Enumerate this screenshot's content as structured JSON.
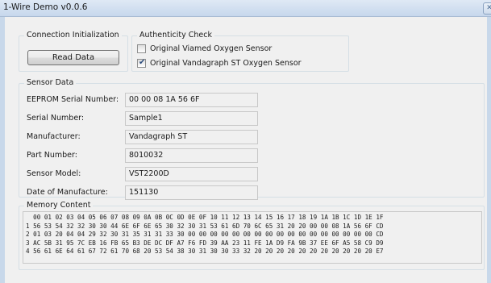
{
  "window": {
    "title": "1-Wire Demo v0.0.6"
  },
  "connection": {
    "group_label": "Connection Initialization",
    "read_button_label": "Read Data"
  },
  "authenticity": {
    "group_label": "Authenticity Check",
    "options": [
      {
        "label": "Original Viamed Oxygen Sensor",
        "checked": false
      },
      {
        "label": "Original Vandagraph ST Oxygen Sensor",
        "checked": true
      }
    ]
  },
  "sensor": {
    "group_label": "Sensor Data",
    "fields": [
      {
        "label": "EEPROM Serial Number:",
        "value": "00 00 08 1A 56 6F"
      },
      {
        "label": "Serial Number:",
        "value": "Sample1"
      },
      {
        "label": "Manufacturer:",
        "value": "Vandagraph ST"
      },
      {
        "label": "Part Number:",
        "value": "8010032"
      },
      {
        "label": "Sensor Model:",
        "value": "VST2200D"
      },
      {
        "label": "Date of Manufacture:",
        "value": "151130"
      }
    ]
  },
  "memory": {
    "group_label": "Memory Content",
    "header": "  00 01 02 03 04 05 06 07 08 09 0A 0B 0C 0D 0E 0F 10 11 12 13 14 15 16 17 18 19 1A 1B 1C 1D 1E 1F",
    "rows": [
      "1 56 53 54 32 32 30 30 44 6E 6F 6E 65 30 32 30 31 53 61 6D 70 6C 65 31 20 20 00 00 08 1A 56 6F CD",
      "2 01 03 20 04 04 29 32 30 31 35 31 31 33 30 00 00 00 00 00 00 00 00 00 00 00 00 00 00 00 00 00 CD",
      "3 AC 5B 31 95 7C EB 16 FB 65 B3 DE DC DF A7 F6 FD 39 AA 23 11 FE 1A D9 FA 9B 37 EE 6F A5 58 C9 D9",
      "4 56 61 6E 64 61 67 72 61 70 68 20 53 54 38 30 31 30 30 33 32 20 20 20 20 20 20 20 20 20 20 20 E7"
    ]
  }
}
